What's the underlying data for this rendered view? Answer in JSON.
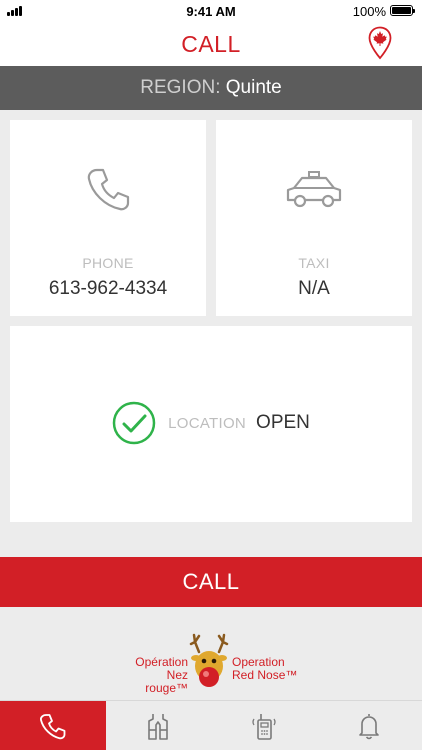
{
  "status_bar": {
    "time": "9:41 AM",
    "battery_percent": "100%"
  },
  "header": {
    "title": "CALL"
  },
  "region": {
    "label": "REGION:",
    "value": "Quinte"
  },
  "cards": {
    "phone": {
      "label": "PHONE",
      "value": "613-962-4334"
    },
    "taxi": {
      "label": "TAXI",
      "value": "N/A"
    },
    "location": {
      "label": "LOCATION",
      "value": "OPEN"
    }
  },
  "call_button": {
    "label": "CALL"
  },
  "logo": {
    "french": [
      "Opération",
      "Nez rouge™"
    ],
    "english": [
      "Operation",
      "Red Nose™"
    ]
  },
  "tabs": [
    {
      "icon": "phone-icon",
      "active": true
    },
    {
      "icon": "vest-icon",
      "active": false
    },
    {
      "icon": "walkie-talkie-icon",
      "active": false
    },
    {
      "icon": "bell-icon",
      "active": false
    }
  ],
  "colors": {
    "accent": "#d21f26",
    "region_bar": "#5c5c5c",
    "success": "#2fb34a",
    "background": "#ececec"
  }
}
